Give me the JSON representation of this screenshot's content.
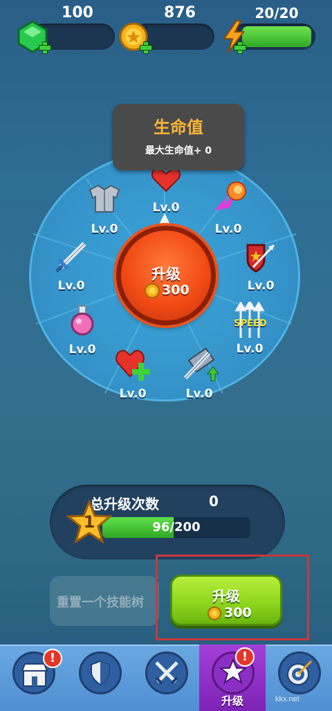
{
  "resources": {
    "gems": "100",
    "coins": "876",
    "energy": "20/20"
  },
  "tooltip": {
    "title": "生命值",
    "desc": "最大生命值+ 0"
  },
  "skills": [
    {
      "name": "heart",
      "level": "Lv.0"
    },
    {
      "name": "fireball",
      "level": "Lv.0"
    },
    {
      "name": "shield",
      "level": "Lv.0"
    },
    {
      "name": "speed",
      "level": "Lv.0"
    },
    {
      "name": "sword-upgrade",
      "level": "Lv.0"
    },
    {
      "name": "heal",
      "level": "Lv.0"
    },
    {
      "name": "potion",
      "level": "Lv.0"
    },
    {
      "name": "sword",
      "level": "Lv.0"
    },
    {
      "name": "armor",
      "level": "Lv.0"
    }
  ],
  "speed_text": "SPEED",
  "center": {
    "label": "升级",
    "cost": "300"
  },
  "total": {
    "label": "总升级次数",
    "count": "0",
    "star_level": "1",
    "progress_text": "96/200",
    "progress_fraction": 0.48
  },
  "buttons": {
    "reset_label": "重置一个技能树",
    "upgrade_label": "升级",
    "upgrade_cost": "300"
  },
  "nav": {
    "active_label": "升级",
    "badge": "!"
  },
  "watermark": "kkx.net"
}
